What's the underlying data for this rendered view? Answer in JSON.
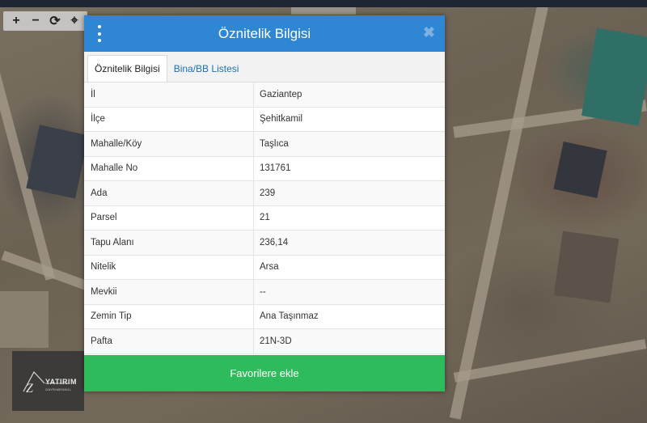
{
  "map": {
    "tools": [
      {
        "name": "zoom-in-icon",
        "glyph": "+"
      },
      {
        "name": "zoom-out-icon",
        "glyph": "−"
      },
      {
        "name": "refresh-icon",
        "glyph": "⟳"
      },
      {
        "name": "crosshair-icon",
        "glyph": "⌖"
      }
    ]
  },
  "logo": {
    "text": "YATIRIM",
    "sub": "GAYRIMENKUL"
  },
  "panel": {
    "title": "Öznitelik Bilgisi",
    "close_glyph": "✖",
    "tabs": [
      {
        "label": "Öznitelik Bilgisi",
        "active": true
      },
      {
        "label": "Bina/BB Listesi",
        "active": false
      }
    ],
    "rows": [
      {
        "key": "İl",
        "value": "Gaziantep"
      },
      {
        "key": "İlçe",
        "value": "Şehitkamil"
      },
      {
        "key": "Mahalle/Köy",
        "value": "Taşlıca"
      },
      {
        "key": "Mahalle No",
        "value": "131761"
      },
      {
        "key": "Ada",
        "value": "239"
      },
      {
        "key": "Parsel",
        "value": "21"
      },
      {
        "key": "Tapu Alanı",
        "value": "236,14"
      },
      {
        "key": "Nitelik",
        "value": "Arsa"
      },
      {
        "key": "Mevkii",
        "value": "--"
      },
      {
        "key": "Zemin Tip",
        "value": "Ana Taşınmaz"
      },
      {
        "key": "Pafta",
        "value": "21N-3D"
      }
    ],
    "favorite_label": "Favorilere ekle"
  },
  "colors": {
    "header": "#2f87d4",
    "favorite": "#2ebb5b",
    "tab_link": "#1f6fb5"
  }
}
